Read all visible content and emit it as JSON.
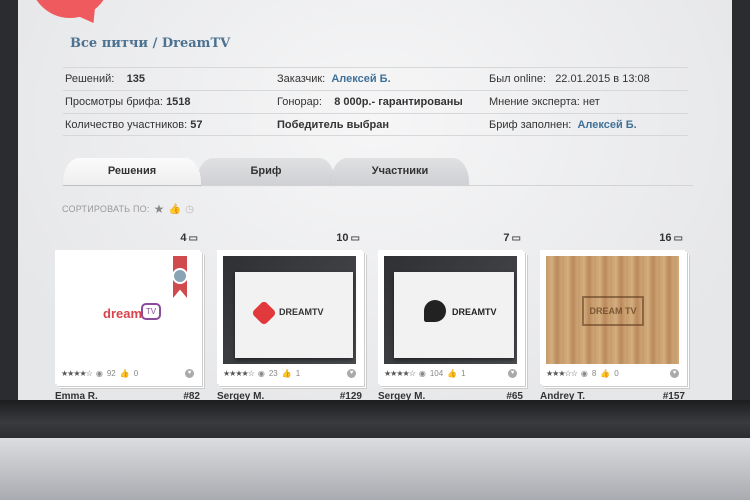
{
  "breadcrumb": "Все питчи / DreamTV",
  "info": {
    "row1": {
      "solutions_label": "Решений:",
      "solutions_value": "135",
      "client_label": "Заказчик:",
      "client_value": "Алексей Б.",
      "online_label": "Был online:",
      "online_value": "22.01.2015 в 13:08"
    },
    "row2": {
      "views_label": "Просмотры брифа:",
      "views_value": "1518",
      "fee_label": "Гонорар:",
      "fee_value": "8 000р.- гарантированы",
      "expert_label": "Мнение эксперта:",
      "expert_value": "нет"
    },
    "row3": {
      "participants_label": "Количество участников:",
      "participants_value": "57",
      "winner_text": "Победитель выбран",
      "brief_label": "Бриф заполнен:",
      "brief_value": "Алексей Б."
    }
  },
  "tabs": [
    "Решения",
    "Бриф",
    "Участники"
  ],
  "sort_label": "СОРТИРОВАТЬ ПО:",
  "cards": [
    {
      "count": "4",
      "views": "92",
      "likes": "0",
      "author": "Emma R.",
      "number": "#82",
      "rating": "★★★★☆",
      "logo_text": "dream"
    },
    {
      "count": "10",
      "views": "23",
      "likes": "1",
      "author": "Sergey M.",
      "number": "#129",
      "rating": "★★★★☆",
      "logo_text": "DREAMTV"
    },
    {
      "count": "7",
      "views": "104",
      "likes": "1",
      "author": "Sergey M.",
      "number": "#65",
      "rating": "★★★★☆",
      "logo_text": "DREAMTV"
    },
    {
      "count": "16",
      "views": "8",
      "likes": "0",
      "author": "Andrey T.",
      "number": "#157",
      "rating": "★★★☆☆",
      "logo_text": "DREAM TV"
    }
  ],
  "colors": {
    "accent": "#3f7199",
    "brand_red": "#ef5a5e"
  }
}
